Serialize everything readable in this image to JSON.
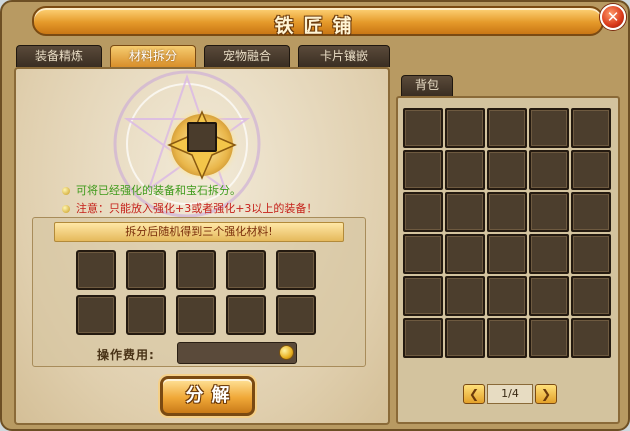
{
  "window": {
    "title": "铁匠铺",
    "close_label": "✕"
  },
  "tabs": [
    {
      "label": "装备精炼",
      "active": false
    },
    {
      "label": "材料拆分",
      "active": true
    },
    {
      "label": "宠物融合",
      "active": false
    },
    {
      "label": "卡片镶嵌",
      "active": false
    }
  ],
  "split": {
    "hint_green": "可将已经强化的装备和宝石拆分。",
    "hint_red": "注意：只能放入强化+3或者强化+3以上的装备！",
    "result_header": "拆分后随机得到三个强化材料!",
    "fee_label": "操作费用:",
    "fee_value": "",
    "decompose_label": "分解"
  },
  "bag": {
    "tab_label": "背包",
    "page": "1/4",
    "prev_label": "❮",
    "next_label": "❯"
  },
  "colors": {
    "accent_gold": "#e59a2a",
    "hint_green": "#3d9a1a",
    "hint_red": "#c5211a",
    "slot_brown": "#4c3e2d"
  }
}
